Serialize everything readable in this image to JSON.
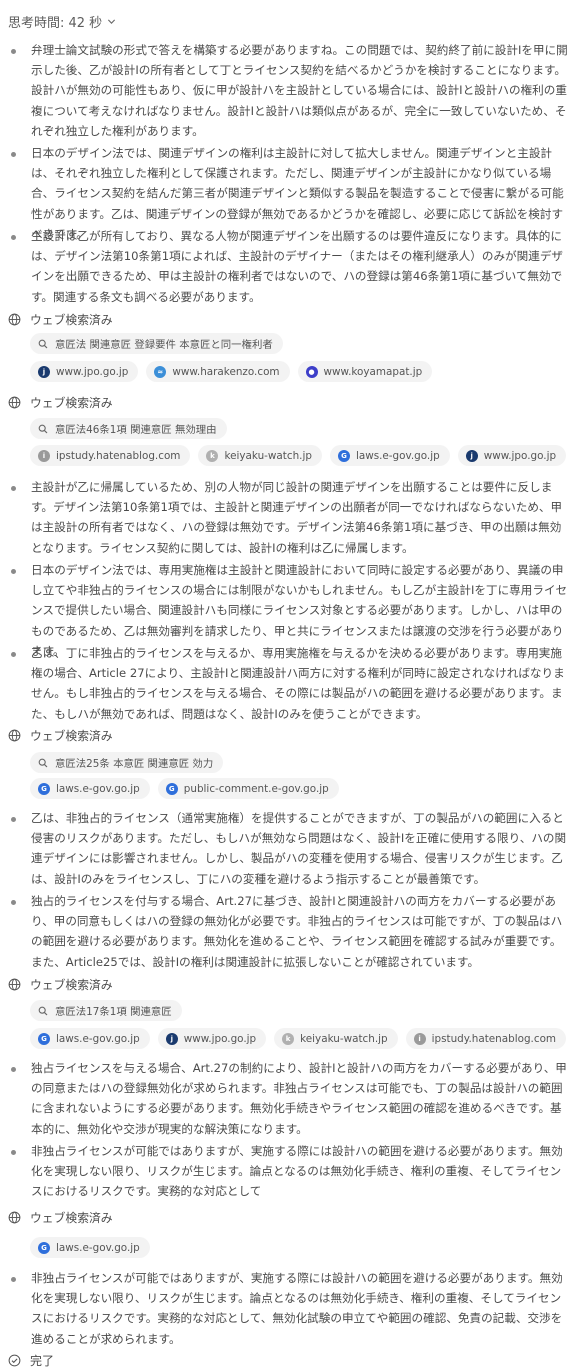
{
  "header": {
    "title": "思考時間: 42 秒"
  },
  "web_search_label": "ウェブ検索済み",
  "paragraphs": [
    "弁理士論文試験の形式で答えを構築する必要がありますね。この問題では、契約終了前に設計Iを甲に開示した後、乙が設計Iの所有者として丁とライセンス契約を結べるかどうかを検討することになります。設計ハが無効の可能性もあり、仮に甲が設計ハを主設計としている場合には、設計Iと設計ハの権利の重複について考えなければなりません。設計Iと設計ハは類似点があるが、完全に一致していないため、それぞれ独立した権利があります。",
    "日本のデザイン法では、関連デザインの権利は主設計に対して拡大しません。関連デザインと主設計は、それぞれ独立した権利として保護されます。ただし、関連デザインが主設計にかなり似ている場合、ライセンス契約を結んだ第三者が関連デザインと類似する製品を製造することで侵害に繋がる可能性があります。乙は、関連デザインの登録が無効であるかどうかを確認し、必要に応じて訴訟を検討すべきです。",
    "主設計は乙が所有しており、異なる人物が関連デザインを出願するのは要件違反になります。具体的には、デザイン法第10条第1項によれば、主設計のデザイナー（またはその権利継承人）のみが関連デザインを出願できるため、甲は主設計の権利者ではないので、ハの登録は第46条第1項に基づいて無効です。関連する条文も調べる必要があります。",
    "主設計が乙に帰属しているため、別の人物が同じ設計の関連デザインを出願することは要件に反します。デザイン法第10条第1項では、主設計と関連デザインの出願者が同一でなければならないため、甲は主設計の所有者ではなく、ハの登録は無効です。デザイン法第46条第1項に基づき、甲の出願は無効となります。ライセンス契約に関しては、設計Iの権利は乙に帰属します。",
    "日本のデザイン法では、専用実施権は主設計と関連設計において同時に設定する必要があり、異議の申し立てや非独占的ライセンスの場合には制限がないかもしれません。もし乙が主設計Iを丁に専用ライセンスで提供したい場合、関連設計ハも同様にライセンス対象とする必要があります。しかし、ハは甲のものであるため、乙は無効審判を請求したり、甲と共にライセンスまたは譲渡の交渉を行う必要があります。",
    "乙は、丁に非独占的ライセンスを与えるか、専用実施権を与えるかを決める必要があります。専用実施権の場合、Article 27により、主設計Iと関連設計ハ両方に対する権利が同時に設定されなければなりません。もし非独占的ライセンスを与える場合、その際には製品がハの範囲を避ける必要があります。また、もしハが無効であれば、問題はなく、設計Iのみを使うことができます。",
    "乙は、非独占的ライセンス（通常実施権）を提供することができますが、丁の製品がハの範囲に入ると侵害のリスクがあります。ただし、もしハが無効なら問題はなく、設計Iを正確に使用する限り、ハの関連デザインには影響されません。しかし、製品がハの変種を使用する場合、侵害リスクが生じます。乙は、設計Iのみをライセンスし、丁にハの変種を避けるよう指示することが最善策です。",
    "独占的ライセンスを付与する場合、Art.27に基づき、設計Iと関連設計ハの両方をカバーする必要があり、甲の同意もしくはハの登録の無効化が必要です。非独占的ライセンスは可能ですが、丁の製品はハの範囲を避ける必要があります。無効化を進めることや、ライセンス範囲を確認する試みが重要です。また、Article25では、設計Iの権利は関連設計に拡張しないことが確認されています。",
    "独占ライセンスを与える場合、Art.27の制約により、設計Iと設計ハの両方をカバーする必要があり、甲の同意またはハの登録無効化が求められます。非独占ライセンスは可能でも、丁の製品は設計ハの範囲に含まれないようにする必要があります。無効化手続きやライセンス範囲の確認を進めるべきです。基本的に、無効化や交渉が現実的な解決策になります。",
    "非独占ライセンスが可能ではありますが、実施する際には設計ハの範囲を避ける必要があります。無効化を実現しない限り、リスクが生じます。論点となるのは無効化手続き、権利の重複、そしてライセンスにおけるリスクです。実務的な対応として",
    "非独占ライセンスが可能ではありますが、実施する際には設計ハの範囲を避ける必要があります。無効化を実現しない限り、リスクが生じます。論点となるのは無効化手続き、権利の重複、そしてライセンスにおけるリスクです。実務的な対応として、無効化試験の申立てや範囲の確認、免責の記載、交渉を進めることが求められます。"
  ],
  "searches": [
    {
      "query": "意匠法 関連意匠 登録要件 本意匠と同一権利者",
      "sources": [
        "www.jpo.go.jp",
        "www.harakenzo.com",
        "www.koyamapat.jp"
      ]
    },
    {
      "query": "意匠法46条1項 関連意匠 無効理由",
      "sources": [
        "ipstudy.hatenablog.com",
        "keiyaku-watch.jp",
        "laws.e-gov.go.jp",
        "www.jpo.go.jp"
      ]
    },
    {
      "query": "意匠法25条 本意匠 関連意匠 効力",
      "sources": [
        "laws.e-gov.go.jp",
        "public-comment.e-gov.go.jp"
      ]
    },
    {
      "query": "意匠法17条1項 関連意匠",
      "sources": [
        "laws.e-gov.go.jp",
        "www.jpo.go.jp",
        "keiyaku-watch.jp",
        "ipstudy.hatenablog.com"
      ]
    },
    {
      "query": "",
      "sources": [
        "laws.e-gov.go.jp"
      ]
    }
  ],
  "footer": {
    "done": "完了"
  },
  "colors": {
    "egov": "#2f6fdb",
    "jpo": "#1a3a6e",
    "harakenzo": "#3c8fd8",
    "koyamapat": "#3e3fc9",
    "hatena": "#9a9a9a",
    "keiyaku": "#b0b0b0"
  },
  "icons": [
    "chevron-down-icon",
    "bullet-dot",
    "globe-icon",
    "search-icon",
    "site-favicon",
    "check-circle-icon"
  ]
}
